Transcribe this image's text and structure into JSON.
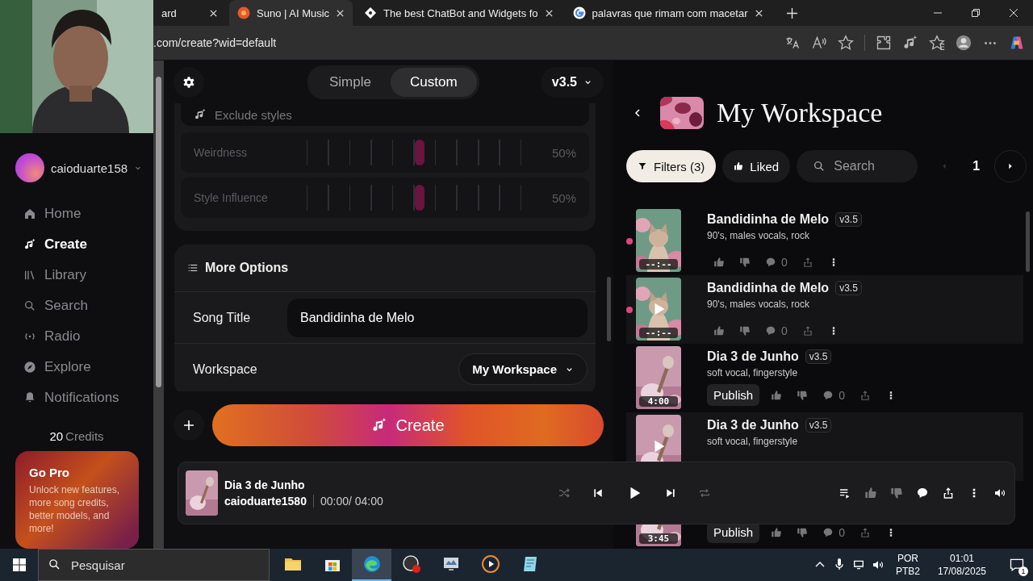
{
  "browser": {
    "tabs": [
      {
        "title": "ard",
        "selected": false
      },
      {
        "title": "Suno | AI Music",
        "selected": true,
        "kind": "suno"
      },
      {
        "title": "The best ChatBot and Widgets fo",
        "selected": false,
        "kind": "diamond"
      },
      {
        "title": "palavras que rimam com macetar",
        "selected": false,
        "kind": "google"
      }
    ],
    "url": ".com/create?wid=default"
  },
  "sidebar": {
    "username": "caioduarte158",
    "nav": [
      {
        "label": "Home",
        "selected": false
      },
      {
        "label": "Create",
        "selected": true
      },
      {
        "label": "Library",
        "selected": false
      },
      {
        "label": "Search",
        "selected": false
      },
      {
        "label": "Radio",
        "selected": false
      },
      {
        "label": "Explore",
        "selected": false
      },
      {
        "label": "Notifications",
        "selected": false
      }
    ],
    "credits_count": "20",
    "credits_label": "Credits",
    "promo": {
      "title": "Go Pro",
      "text": "Unlock new features, more song credits, better models, and more!"
    }
  },
  "create_panel": {
    "modes": [
      {
        "label": "Simple",
        "selected": false
      },
      {
        "label": "Custom",
        "selected": true
      }
    ],
    "version": "v3.5",
    "exclude_styles_placeholder": "Exclude styles",
    "sliders": [
      {
        "label": "Weirdness",
        "level": 0.5,
        "reading": "50%"
      },
      {
        "label": "Style Influence",
        "level": 0.5,
        "reading": "50%"
      }
    ],
    "more_options": {
      "title": "More Options",
      "song_title_label": "Song Title",
      "song_title_value": "Bandidinha de Melo",
      "workspace_label": "Workspace",
      "workspace_value": "My Workspace"
    },
    "create_button": "Create"
  },
  "workspace": {
    "title": "My Workspace",
    "filters_button": "Filters (3)",
    "liked_button": "Liked",
    "search_placeholder": "Search",
    "page": "1",
    "songs": [
      {
        "title": "Bandidinha de Melo",
        "version": "v3.5",
        "tags": "90's, males vocals, rock",
        "duration": "--:--",
        "unread": true,
        "hovered": false,
        "comments": "0"
      },
      {
        "title": "Bandidinha de Melo",
        "version": "v3.5",
        "tags": "90's, males vocals, rock",
        "duration": "--:--",
        "unread": true,
        "hovered": true,
        "comments": "0"
      },
      {
        "title": "Dia 3 de Junho",
        "version": "v3.5",
        "tags": "soft vocal, fingerstyle",
        "duration": "4:00",
        "unread": false,
        "hovered": false,
        "publish": "Publish",
        "comments": "0"
      },
      {
        "title": "Dia 3 de Junho",
        "version": "v3.5",
        "tags": "soft vocal, fingerstyle",
        "unread": false,
        "hovered": true
      },
      {
        "duration": "3:45",
        "unread": false,
        "hovered": false,
        "publish": "Publish",
        "comments": "0"
      }
    ]
  },
  "player": {
    "title": "Dia 3 de Junho",
    "artist": "caioduarte1580",
    "time": "00:00/ 04:00"
  },
  "taskbar": {
    "search_placeholder": "Pesquisar",
    "apps": [
      {
        "kind": "folder",
        "selected": false
      },
      {
        "kind": "store",
        "selected": false
      },
      {
        "kind": "browser",
        "selected": true
      },
      {
        "kind": "record",
        "selected": false
      },
      {
        "kind": "monitor",
        "selected": false
      },
      {
        "kind": "player",
        "selected": false
      },
      {
        "kind": "notes",
        "selected": false
      }
    ],
    "language": "POR",
    "layout": "PTB2",
    "time": "01:01",
    "date": "17/08/2025",
    "notifications": "1"
  }
}
